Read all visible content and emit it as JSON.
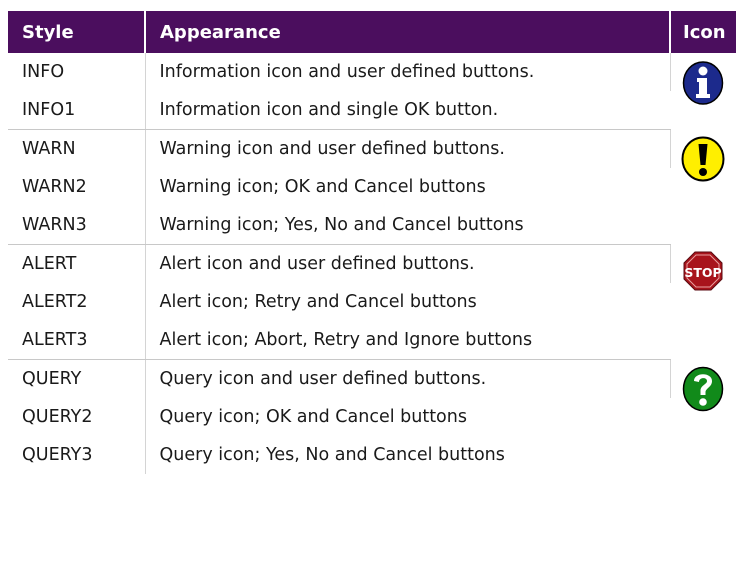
{
  "headers": {
    "style": "Style",
    "appearance": "Appearance",
    "icon": "Icon"
  },
  "groups": [
    {
      "icon": "info-icon",
      "rows": [
        {
          "style": "INFO",
          "appearance": "Information icon and user defined buttons."
        },
        {
          "style": "INFO1",
          "appearance": "Information icon and single OK button."
        }
      ]
    },
    {
      "icon": "warning-icon",
      "rows": [
        {
          "style": "WARN",
          "appearance": "Warning icon and user defined buttons."
        },
        {
          "style": "WARN2",
          "appearance": "Warning icon; OK and Cancel buttons"
        },
        {
          "style": "WARN3",
          "appearance": "Warning icon; Yes, No and Cancel buttons"
        }
      ]
    },
    {
      "icon": "stop-icon",
      "icon_text": "STOP",
      "rows": [
        {
          "style": "ALERT",
          "appearance": "Alert icon and user defined buttons."
        },
        {
          "style": "ALERT2",
          "appearance": "Alert icon; Retry and Cancel buttons"
        },
        {
          "style": "ALERT3",
          "appearance": "Alert icon; Abort, Retry and Ignore buttons"
        }
      ]
    },
    {
      "icon": "question-icon",
      "rows": [
        {
          "style": "QUERY",
          "appearance": "Query icon and user defined buttons."
        },
        {
          "style": "QUERY2",
          "appearance": "Query icon; OK and Cancel buttons"
        },
        {
          "style": "QUERY3",
          "appearance": "Query icon; Yes, No and Cancel buttons"
        }
      ]
    }
  ],
  "colors": {
    "header_bg": "#4b0e5e",
    "info_blue": "#1c2a8c",
    "warn_yellow": "#ffef00",
    "stop_red": "#a8141c",
    "query_green": "#118a1a"
  }
}
